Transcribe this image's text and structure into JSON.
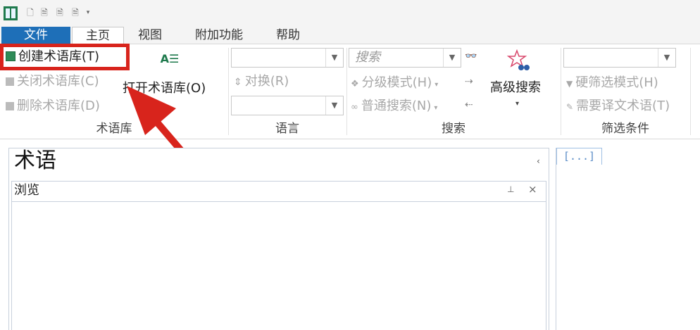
{
  "menu": {
    "tabs": [
      "文件",
      "主页",
      "视图",
      "附加功能",
      "帮助"
    ]
  },
  "ribbon": {
    "termbase_group": {
      "label": "术语库",
      "create": "创建术语库(T)",
      "close": "关闭术语库(C)",
      "delete": "删除术语库(D)",
      "open": "打开术语库(O)",
      "open_icon_text": "A☰"
    },
    "language_group": {
      "label": "语言",
      "swap": "对换(R)"
    },
    "search_group": {
      "label": "搜索",
      "search_placeholder": "搜索",
      "hierarchical": "分级模式(H)",
      "normal_search": "普通搜索(N)",
      "advanced": "高级搜索"
    },
    "filter_group": {
      "label": "筛选条件",
      "hard_filter": "硬筛选模式(H)",
      "need_translation": "需要译文术语(T)"
    }
  },
  "panel": {
    "title": "术语",
    "browse_label": "浏览",
    "right_tab": "[...]"
  },
  "colors": {
    "file_tab": "#1e6fb8",
    "highlight": "#d8241c"
  }
}
